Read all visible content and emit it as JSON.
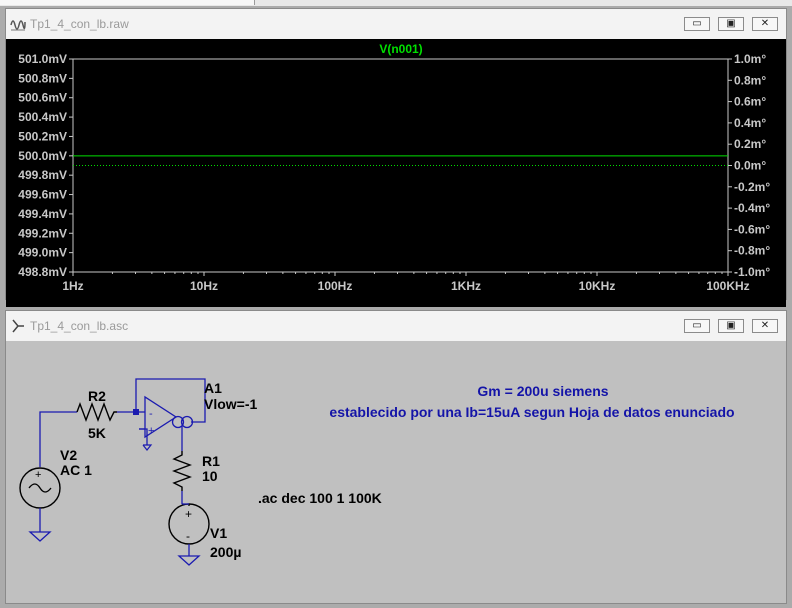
{
  "plot_window": {
    "title": "Tp1_4_con_lb.raw",
    "trace_name": "V(n001)",
    "y_left_ticks": [
      "501.0mV",
      "500.8mV",
      "500.6mV",
      "500.4mV",
      "500.2mV",
      "500.0mV",
      "499.8mV",
      "499.6mV",
      "499.4mV",
      "499.2mV",
      "499.0mV",
      "498.8mV"
    ],
    "y_right_ticks": [
      "1.0m°",
      "0.8m°",
      "0.6m°",
      "0.4m°",
      "0.2m°",
      "0.0m°",
      "-0.2m°",
      "-0.4m°",
      "-0.6m°",
      "-0.8m°",
      "-1.0m°"
    ],
    "x_ticks": [
      "1Hz",
      "10Hz",
      "100Hz",
      "1KHz",
      "10KHz",
      "100KHz"
    ],
    "colors": {
      "magnitude": "#00e000",
      "phase": "#00e000",
      "background": "#000000",
      "axes": "#c8c8c8"
    }
  },
  "chart_data": {
    "type": "line",
    "title": "V(n001)",
    "x_scale": "log",
    "xlim": [
      "1Hz",
      "100KHz"
    ],
    "ylim_left": [
      "498.8mV",
      "501.0mV"
    ],
    "ylim_right": [
      "-1.0m°",
      "1.0m°"
    ],
    "grid": false,
    "series": [
      {
        "name": "V(n001)",
        "axis": "left",
        "style": "solid",
        "x": [
          "1Hz",
          "100KHz"
        ],
        "y": [
          "500.0mV",
          "500.0mV"
        ]
      },
      {
        "name": "V(n001)",
        "axis": "right",
        "style": "dotted",
        "x": [
          "1Hz",
          "100KHz"
        ],
        "y": [
          "0.0m°",
          "0.0m°"
        ]
      }
    ]
  },
  "schematic_window": {
    "title": "Tp1_4_con_lb.asc",
    "components": {
      "r2_name": "R2",
      "r2_value": "5K",
      "a1_name": "A1",
      "a1_value": "Vlow=-1",
      "v2_name": "V2",
      "v2_value": "AC 1",
      "r1_name": "R1",
      "r1_value": "10",
      "v1_name": "V1",
      "v1_value": "200µ"
    },
    "directive": ".ac dec 100 1 100K",
    "comment_line1": "Gm = 200u siemens",
    "comment_line2": "establecido por una Ib=15uA segun Hoja de datos enunciado"
  },
  "window_controls": {
    "minimize": "▭",
    "maximize": "▣",
    "close": "✕"
  }
}
